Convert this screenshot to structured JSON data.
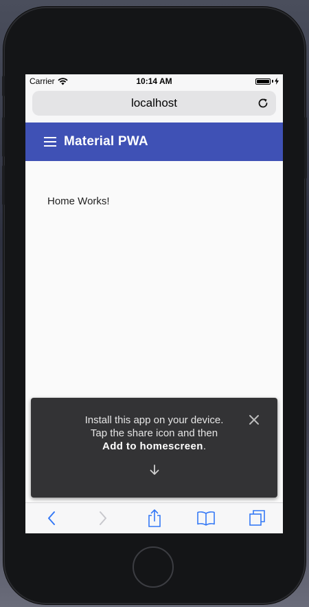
{
  "status_bar": {
    "carrier": "Carrier",
    "time": "10:14 AM",
    "wifi_icon": "wifi-icon",
    "battery_icon": "battery-icon",
    "charging_icon": "charging-bolt-icon"
  },
  "browser": {
    "url": "localhost",
    "reload_icon": "reload-icon"
  },
  "app_bar": {
    "menu_icon": "hamburger-menu-icon",
    "title": "Material PWA",
    "color": "#3f51b5"
  },
  "content": {
    "text": "Home Works!"
  },
  "install_banner": {
    "line1": "Install this app on your device.",
    "line2": "Tap the share icon and then",
    "action": "Add to homescreen",
    "action_suffix": ".",
    "close_icon": "close-icon",
    "arrow_icon": "arrow-down-icon",
    "background": "#333335"
  },
  "safari_toolbar": {
    "items": [
      "back-icon",
      "forward-icon",
      "share-icon",
      "bookmarks-icon",
      "tabs-icon"
    ]
  }
}
